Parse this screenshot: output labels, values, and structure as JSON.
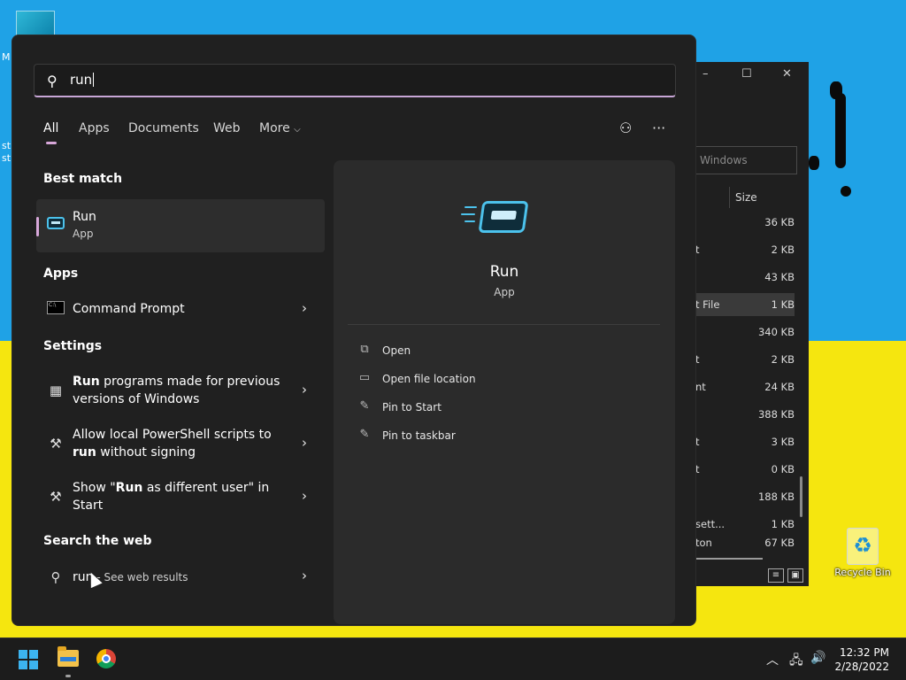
{
  "desktop": {
    "fragments": [
      "M",
      "st",
      "st"
    ],
    "recycle_bin_label": "Recycle Bin"
  },
  "explorer": {
    "controls": [
      "–",
      "☐",
      "✕"
    ],
    "search_placeholder": "Windows",
    "column_header": "Size",
    "rows": [
      {
        "name": "",
        "size": "36 KB"
      },
      {
        "name": "t",
        "size": "2 KB"
      },
      {
        "name": "",
        "size": "43 KB"
      },
      {
        "name": "t File",
        "size": "1 KB"
      },
      {
        "name": "",
        "size": "340 KB"
      },
      {
        "name": "t",
        "size": "2 KB"
      },
      {
        "name": "nt",
        "size": "24 KB"
      },
      {
        "name": "",
        "size": "388 KB"
      },
      {
        "name": "t",
        "size": "3 KB"
      },
      {
        "name": "t",
        "size": "0 KB"
      },
      {
        "name": "",
        "size": "188 KB"
      },
      {
        "name": "sett...",
        "size": "1 KB"
      },
      {
        "name": "ton",
        "size": "67 KB"
      }
    ]
  },
  "search": {
    "query": "run",
    "tabs": [
      "All",
      "Apps",
      "Documents",
      "Web",
      "More"
    ],
    "tabs_selected": "All"
  },
  "sections": {
    "best_match": "Best match",
    "apps": "Apps",
    "settings": "Settings",
    "web": "Search the web"
  },
  "best_match": {
    "title": "Run",
    "subtitle": "App"
  },
  "apps": [
    {
      "title": "Command Prompt"
    }
  ],
  "settings": [
    {
      "bold": "Run",
      "rest": " programs made for previous",
      "line2": "versions of Windows"
    },
    {
      "pre": "Allow local PowerShell scripts to",
      "bold": "run",
      "rest": " without signing"
    },
    {
      "pre": "Show \"",
      "bold": "Run",
      "rest": " as different user\" in",
      "line2": "Start"
    }
  ],
  "web_result": {
    "query": "run",
    "suffix": " - See web results"
  },
  "preview": {
    "title": "Run",
    "subtitle": "App",
    "actions": [
      {
        "label": "Open",
        "icon": "open-icon"
      },
      {
        "label": "Open file location",
        "icon": "folder-icon"
      },
      {
        "label": "Pin to Start",
        "icon": "pin-icon"
      },
      {
        "label": "Pin to taskbar",
        "icon": "pin-icon"
      }
    ]
  },
  "taskbar": {
    "time": "12:32 PM",
    "date": "2/28/2022"
  },
  "colors": {
    "accent": "#d7a7d9",
    "panel": "#202020",
    "preview_panel": "#2b2b2b",
    "run_icon": "#4cc2ec"
  }
}
